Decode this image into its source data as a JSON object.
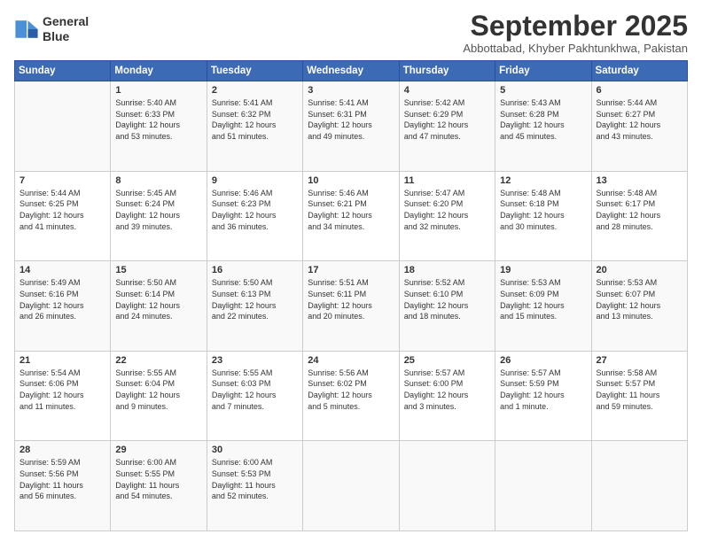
{
  "logo": {
    "line1": "General",
    "line2": "Blue"
  },
  "title": "September 2025",
  "location": "Abbottabad, Khyber Pakhtunkhwa, Pakistan",
  "days_header": [
    "Sunday",
    "Monday",
    "Tuesday",
    "Wednesday",
    "Thursday",
    "Friday",
    "Saturday"
  ],
  "weeks": [
    [
      {
        "day": "",
        "info": ""
      },
      {
        "day": "1",
        "info": "Sunrise: 5:40 AM\nSunset: 6:33 PM\nDaylight: 12 hours\nand 53 minutes."
      },
      {
        "day": "2",
        "info": "Sunrise: 5:41 AM\nSunset: 6:32 PM\nDaylight: 12 hours\nand 51 minutes."
      },
      {
        "day": "3",
        "info": "Sunrise: 5:41 AM\nSunset: 6:31 PM\nDaylight: 12 hours\nand 49 minutes."
      },
      {
        "day": "4",
        "info": "Sunrise: 5:42 AM\nSunset: 6:29 PM\nDaylight: 12 hours\nand 47 minutes."
      },
      {
        "day": "5",
        "info": "Sunrise: 5:43 AM\nSunset: 6:28 PM\nDaylight: 12 hours\nand 45 minutes."
      },
      {
        "day": "6",
        "info": "Sunrise: 5:44 AM\nSunset: 6:27 PM\nDaylight: 12 hours\nand 43 minutes."
      }
    ],
    [
      {
        "day": "7",
        "info": "Sunrise: 5:44 AM\nSunset: 6:25 PM\nDaylight: 12 hours\nand 41 minutes."
      },
      {
        "day": "8",
        "info": "Sunrise: 5:45 AM\nSunset: 6:24 PM\nDaylight: 12 hours\nand 39 minutes."
      },
      {
        "day": "9",
        "info": "Sunrise: 5:46 AM\nSunset: 6:23 PM\nDaylight: 12 hours\nand 36 minutes."
      },
      {
        "day": "10",
        "info": "Sunrise: 5:46 AM\nSunset: 6:21 PM\nDaylight: 12 hours\nand 34 minutes."
      },
      {
        "day": "11",
        "info": "Sunrise: 5:47 AM\nSunset: 6:20 PM\nDaylight: 12 hours\nand 32 minutes."
      },
      {
        "day": "12",
        "info": "Sunrise: 5:48 AM\nSunset: 6:18 PM\nDaylight: 12 hours\nand 30 minutes."
      },
      {
        "day": "13",
        "info": "Sunrise: 5:48 AM\nSunset: 6:17 PM\nDaylight: 12 hours\nand 28 minutes."
      }
    ],
    [
      {
        "day": "14",
        "info": "Sunrise: 5:49 AM\nSunset: 6:16 PM\nDaylight: 12 hours\nand 26 minutes."
      },
      {
        "day": "15",
        "info": "Sunrise: 5:50 AM\nSunset: 6:14 PM\nDaylight: 12 hours\nand 24 minutes."
      },
      {
        "day": "16",
        "info": "Sunrise: 5:50 AM\nSunset: 6:13 PM\nDaylight: 12 hours\nand 22 minutes."
      },
      {
        "day": "17",
        "info": "Sunrise: 5:51 AM\nSunset: 6:11 PM\nDaylight: 12 hours\nand 20 minutes."
      },
      {
        "day": "18",
        "info": "Sunrise: 5:52 AM\nSunset: 6:10 PM\nDaylight: 12 hours\nand 18 minutes."
      },
      {
        "day": "19",
        "info": "Sunrise: 5:53 AM\nSunset: 6:09 PM\nDaylight: 12 hours\nand 15 minutes."
      },
      {
        "day": "20",
        "info": "Sunrise: 5:53 AM\nSunset: 6:07 PM\nDaylight: 12 hours\nand 13 minutes."
      }
    ],
    [
      {
        "day": "21",
        "info": "Sunrise: 5:54 AM\nSunset: 6:06 PM\nDaylight: 12 hours\nand 11 minutes."
      },
      {
        "day": "22",
        "info": "Sunrise: 5:55 AM\nSunset: 6:04 PM\nDaylight: 12 hours\nand 9 minutes."
      },
      {
        "day": "23",
        "info": "Sunrise: 5:55 AM\nSunset: 6:03 PM\nDaylight: 12 hours\nand 7 minutes."
      },
      {
        "day": "24",
        "info": "Sunrise: 5:56 AM\nSunset: 6:02 PM\nDaylight: 12 hours\nand 5 minutes."
      },
      {
        "day": "25",
        "info": "Sunrise: 5:57 AM\nSunset: 6:00 PM\nDaylight: 12 hours\nand 3 minutes."
      },
      {
        "day": "26",
        "info": "Sunrise: 5:57 AM\nSunset: 5:59 PM\nDaylight: 12 hours\nand 1 minute."
      },
      {
        "day": "27",
        "info": "Sunrise: 5:58 AM\nSunset: 5:57 PM\nDaylight: 11 hours\nand 59 minutes."
      }
    ],
    [
      {
        "day": "28",
        "info": "Sunrise: 5:59 AM\nSunset: 5:56 PM\nDaylight: 11 hours\nand 56 minutes."
      },
      {
        "day": "29",
        "info": "Sunrise: 6:00 AM\nSunset: 5:55 PM\nDaylight: 11 hours\nand 54 minutes."
      },
      {
        "day": "30",
        "info": "Sunrise: 6:00 AM\nSunset: 5:53 PM\nDaylight: 11 hours\nand 52 minutes."
      },
      {
        "day": "",
        "info": ""
      },
      {
        "day": "",
        "info": ""
      },
      {
        "day": "",
        "info": ""
      },
      {
        "day": "",
        "info": ""
      }
    ]
  ]
}
